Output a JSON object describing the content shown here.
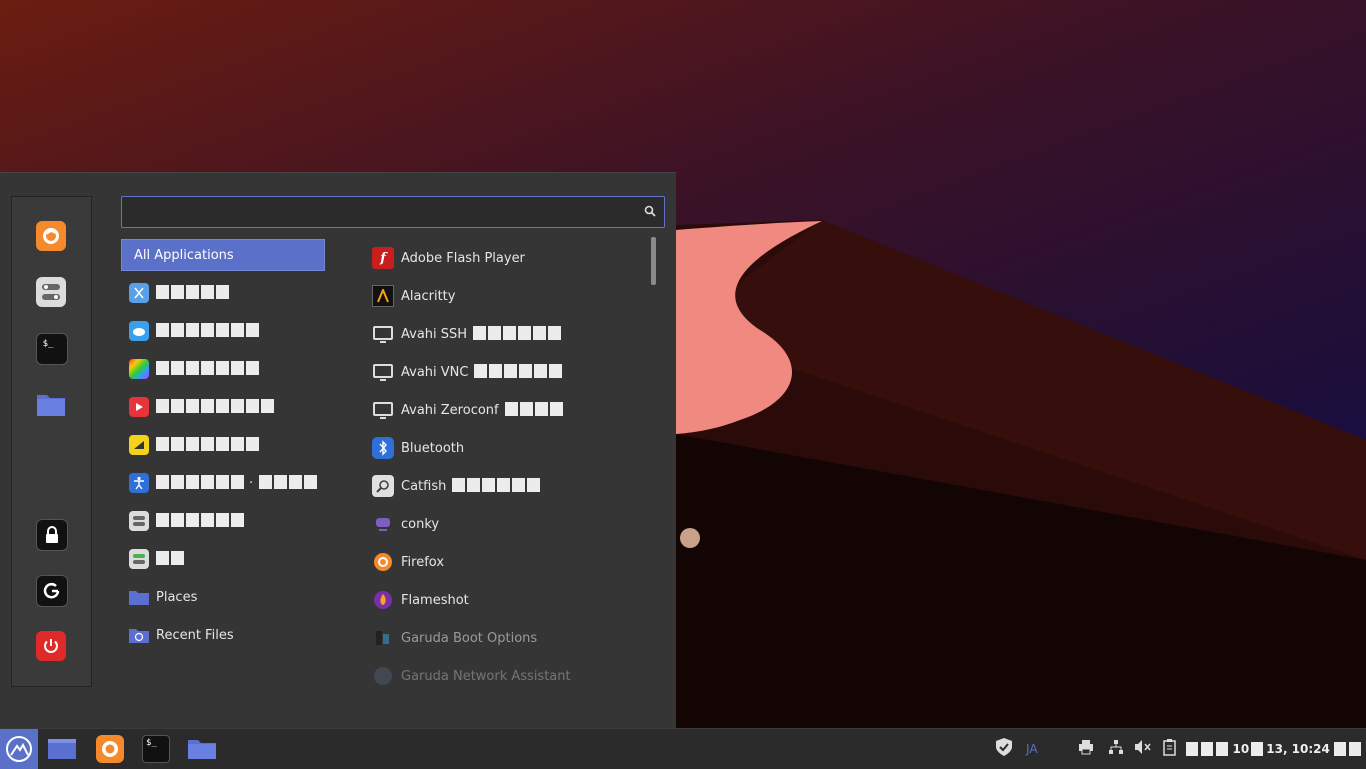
{
  "search": {
    "value": "",
    "placeholder": ""
  },
  "categories": [
    {
      "label": "All Applications",
      "active": true
    },
    {
      "label": "",
      "boxes": 5
    },
    {
      "label": "",
      "boxes": 7
    },
    {
      "label": "",
      "boxes": 7
    },
    {
      "label": "",
      "boxes": 8
    },
    {
      "label": "",
      "boxes": 7
    },
    {
      "label": "",
      "boxes": 7,
      "sep": "·",
      "boxes2": 4
    },
    {
      "label": "",
      "boxes": 6
    },
    {
      "label": "",
      "boxes": 2
    },
    {
      "label": "Places"
    },
    {
      "label": "Recent Files"
    }
  ],
  "apps": [
    {
      "name": "Adobe Flash Player",
      "icon": "flash-player-icon",
      "boxes": 0
    },
    {
      "name": "Alacritty",
      "icon": "alacritty-icon",
      "boxes": 0
    },
    {
      "name": "Avahi SSH",
      "icon": "monitor-icon",
      "boxes": 6
    },
    {
      "name": "Avahi VNC",
      "icon": "monitor-icon",
      "boxes": 6
    },
    {
      "name": "Avahi Zeroconf",
      "icon": "monitor-icon",
      "boxes": 4
    },
    {
      "name": "Bluetooth",
      "icon": "bluetooth-icon",
      "boxes": 0
    },
    {
      "name": "Catfish",
      "icon": "magnifier-icon",
      "boxes": 6
    },
    {
      "name": "conky",
      "icon": "conky-icon",
      "boxes": 0
    },
    {
      "name": "Firefox",
      "icon": "firefox-icon",
      "boxes": 0
    },
    {
      "name": "Flameshot",
      "icon": "flameshot-icon",
      "boxes": 0
    },
    {
      "name": "Garuda Boot Options",
      "icon": "boot-options-icon",
      "boxes": 0
    },
    {
      "name": "Garuda Network Assistant",
      "icon": "network-assistant-icon",
      "boxes": 0
    }
  ],
  "tray": {
    "ime": "JA",
    "clock_boxes_before": 3,
    "clock_text_1": "10",
    "clock_text_2": "13, 10:24",
    "clock_boxes_after": 2
  },
  "colors": {
    "accent": "#5b70c8",
    "firefox": "#f58a2c",
    "power": "#e02a2a",
    "folder": "#5a6fd0"
  }
}
